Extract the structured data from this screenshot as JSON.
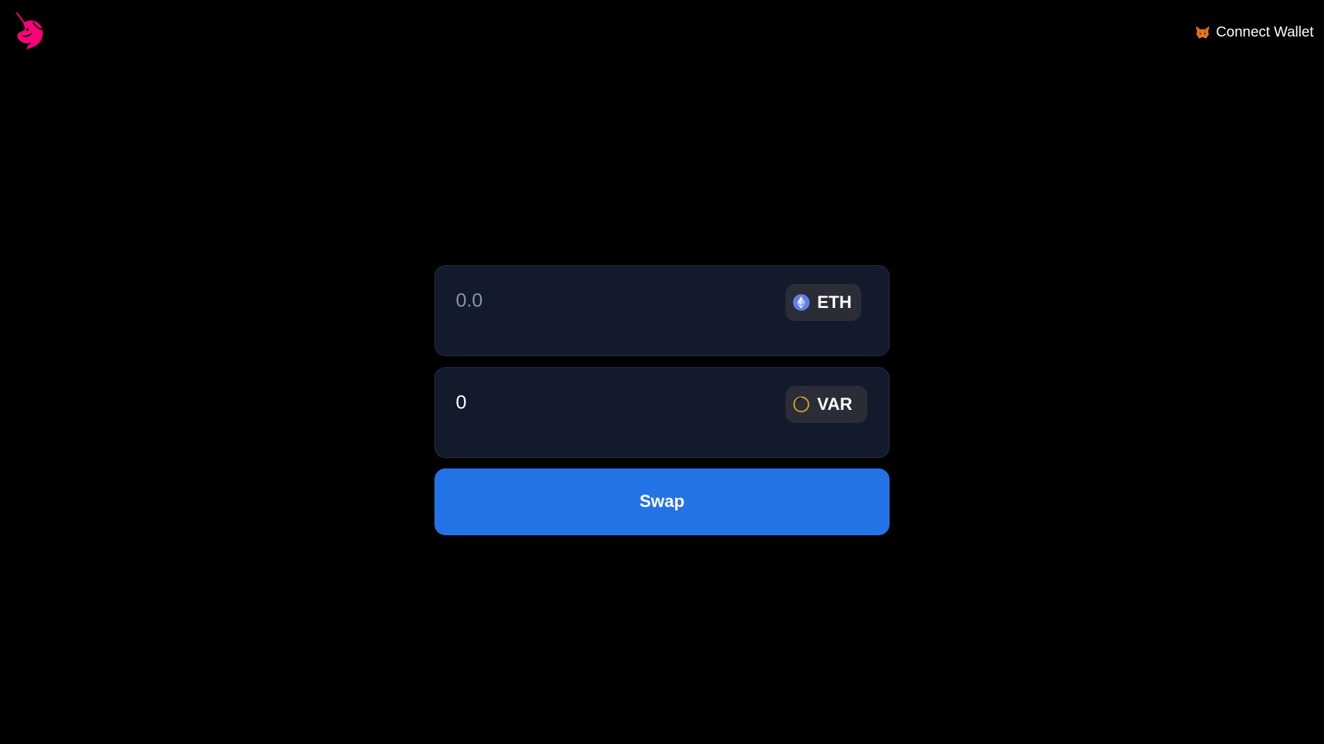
{
  "header": {
    "logo_icon": "uniswap-unicorn-icon",
    "connect_wallet_label": "Connect Wallet",
    "wallet_icon": "metamask-fox-icon"
  },
  "swap": {
    "from": {
      "placeholder": "0.0",
      "value": "",
      "token_symbol": "ETH",
      "token_icon": "ethereum-icon"
    },
    "to": {
      "value": "0",
      "token_symbol": "VAR",
      "token_icon": "var-token-icon"
    },
    "swap_label": "Swap"
  },
  "colors": {
    "background": "#000000",
    "panel": "#121a2c",
    "token_button": "#2a2d36",
    "accent": "#2372e6",
    "logo_pink": "#ff007a"
  }
}
